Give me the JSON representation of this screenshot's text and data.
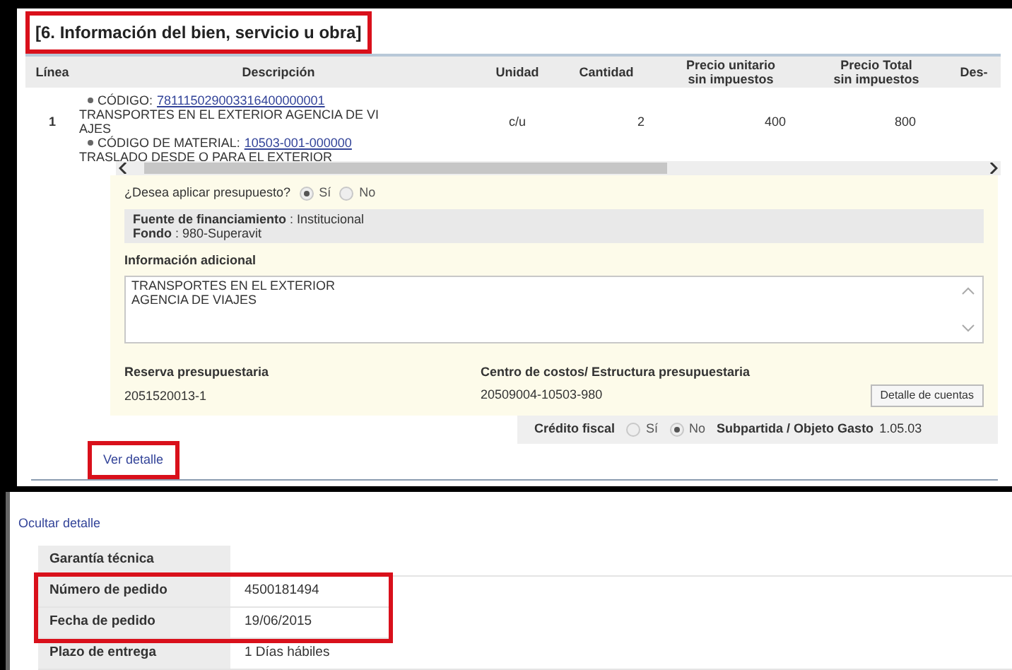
{
  "section": {
    "title": "[6. Información del bien, servicio u obra]",
    "highlighted": true
  },
  "table": {
    "columns": [
      "Línea",
      "Descripción",
      "Unidad",
      "Cantidad",
      "Precio unitario sin impuestos",
      "Precio Total sin impuestos",
      "Des-"
    ],
    "rows": [
      {
        "line": "1",
        "description": [
          {
            "kind": "code",
            "label": "CÓDIGO:",
            "link": "781115029003316400000001"
          },
          {
            "kind": "text",
            "text": "TRANSPORTES EN EL EXTERIOR AGENCIA DE VI"
          },
          {
            "kind": "text",
            "text": "AJES"
          },
          {
            "kind": "code",
            "label": "CÓDIGO DE MATERIAL:",
            "link": "10503-001-000000"
          },
          {
            "kind": "text",
            "text": "TRASLADO DESDE O PARA EL EXTERIOR"
          }
        ],
        "unit": "c/u",
        "quantity": "2",
        "unit_price": "400",
        "total_price": "800"
      }
    ]
  },
  "budget": {
    "question": "¿Desea aplicar presupuesto?",
    "options": [
      {
        "label": "Sí",
        "selected": true
      },
      {
        "label": "No",
        "selected": false
      }
    ],
    "funding": [
      "**Fuente de financiamiento** : Institucional",
      "**Fondo** : 980-Superavit"
    ],
    "additional_info": {
      "label": "Información adicional",
      "value": "TRANSPORTES EN EL EXTERIOR\nAGENCIA DE VIAJES"
    },
    "reserve": {
      "label": "Reserva presupuestaria",
      "value": "2051520013-1"
    },
    "cost_center": {
      "label": "Centro de costos/ Estructura presupuestaria",
      "value": "20509004-10503-980"
    },
    "accounts_button": "Detalle de cuentas"
  },
  "tax_credit": {
    "label": "Crédito fiscal",
    "options": [
      {
        "label": "Sí",
        "selected": false
      },
      {
        "label": "No",
        "selected": true
      }
    ],
    "subitem_label": "Subpartida / Objeto Gasto",
    "subitem_value": "1.05.03"
  },
  "view_detail": {
    "label": "Ver detalle",
    "highlighted": true
  },
  "hide_detail": "Ocultar detalle",
  "details": [
    {
      "label": "Garantía técnica",
      "highlighted": false
    },
    {
      "label": "Número de pedido",
      "value": "4500181494",
      "highlighted": true
    },
    {
      "label": "Fecha de pedido",
      "value": "19/06/2015",
      "highlighted": true
    },
    {
      "label": "Plazo de entrega",
      "value": "1 Días hábiles",
      "highlighted": false
    }
  ]
}
